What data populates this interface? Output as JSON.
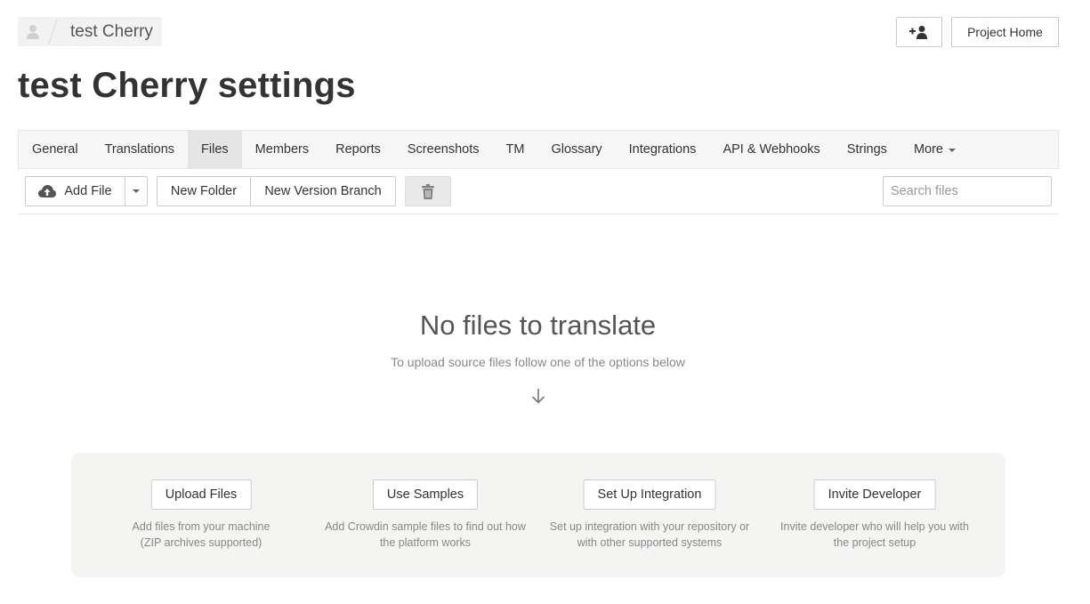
{
  "breadcrumb": {
    "project_name": "test Cherry"
  },
  "header": {
    "project_home_label": "Project Home",
    "page_title": "test Cherry settings"
  },
  "tabs": [
    {
      "label": "General",
      "active": false
    },
    {
      "label": "Translations",
      "active": false
    },
    {
      "label": "Files",
      "active": true
    },
    {
      "label": "Members",
      "active": false
    },
    {
      "label": "Reports",
      "active": false
    },
    {
      "label": "Screenshots",
      "active": false
    },
    {
      "label": "TM",
      "active": false
    },
    {
      "label": "Glossary",
      "active": false
    },
    {
      "label": "Integrations",
      "active": false
    },
    {
      "label": "API & Webhooks",
      "active": false
    },
    {
      "label": "Strings",
      "active": false
    },
    {
      "label": "More",
      "active": false
    }
  ],
  "toolbar": {
    "add_file_label": "Add File",
    "new_folder_label": "New Folder",
    "new_branch_label": "New Version Branch",
    "search_placeholder": "Search files"
  },
  "empty_state": {
    "title": "No files to translate",
    "subtitle": "To upload source files follow one of the options below"
  },
  "options": [
    {
      "button": "Upload Files",
      "desc_line1": "Add files from your machine",
      "desc_line2": "(ZIP archives supported)"
    },
    {
      "button": "Use Samples",
      "desc_line1": "Add Crowdin sample files to find out how",
      "desc_line2": "the platform works"
    },
    {
      "button": "Set Up Integration",
      "desc_line1": "Set up integration with your repository or",
      "desc_line2": "with other supported systems"
    },
    {
      "button": "Invite Developer",
      "desc_line1": "Invite developer who will help you with",
      "desc_line2": "the project setup"
    }
  ],
  "colors": {
    "tab_bar_bg": "#f7f7f7",
    "active_tab_bg": "#e5e5e5",
    "panel_bg": "#f4f4f3",
    "muted_text": "#888888"
  },
  "icons": [
    "user-avatar-icon",
    "add-user-icon",
    "cloud-upload-icon",
    "caret-down-icon",
    "trash-icon",
    "arrow-down-icon"
  ]
}
